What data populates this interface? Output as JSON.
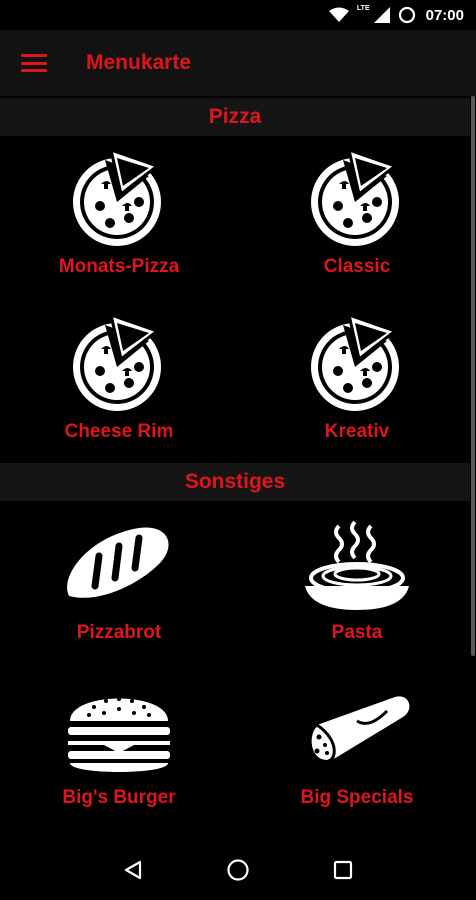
{
  "status_bar": {
    "time": "07:00",
    "network_label": "LTE"
  },
  "app_bar": {
    "title": "Menukarte"
  },
  "sections": [
    {
      "title": "Pizza",
      "items": [
        {
          "label": "Monats-Pizza",
          "icon": "pizza-icon"
        },
        {
          "label": "Classic",
          "icon": "pizza-icon"
        },
        {
          "label": "Cheese Rim",
          "icon": "pizza-icon"
        },
        {
          "label": "Kreativ",
          "icon": "pizza-icon"
        }
      ]
    },
    {
      "title": "Sonstiges",
      "items": [
        {
          "label": "Pizzabrot",
          "icon": "bread-icon"
        },
        {
          "label": "Pasta",
          "icon": "pasta-bowl-icon"
        },
        {
          "label": "Big's Burger",
          "icon": "burger-icon"
        },
        {
          "label": "Big Specials",
          "icon": "wrap-icon"
        }
      ]
    }
  ],
  "colors": {
    "accent": "#e0141e",
    "background": "#000000",
    "header_bg": "#151515",
    "app_bar_bg": "#121212"
  }
}
